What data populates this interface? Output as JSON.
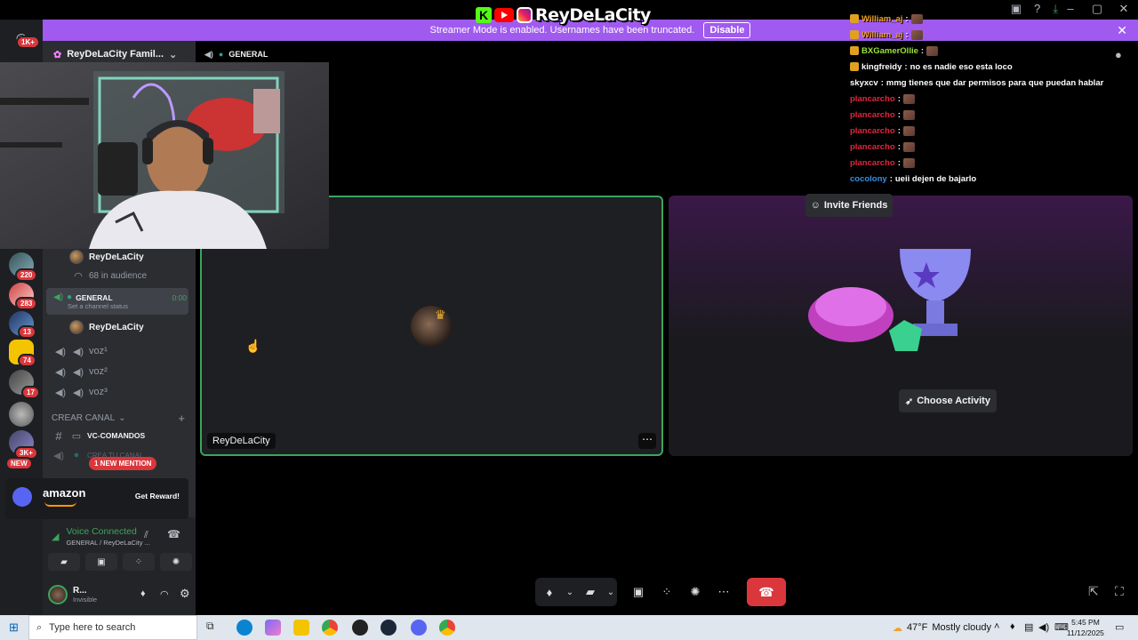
{
  "overlay": {
    "name": "ReyDeLaCity"
  },
  "streamer_bar": {
    "message": "Streamer Mode is enabled. Usernames have been truncated.",
    "disable_label": "Disable"
  },
  "rail_badges": [
    "1K+",
    "220",
    "283",
    "13",
    "74",
    "17",
    "3K+",
    "NEW"
  ],
  "server": {
    "name": "ReyDeLaCity Famil..."
  },
  "header": {
    "channel": "GENERAL"
  },
  "sidebar": {
    "stage_user": "ReyDeLaCity",
    "audience": "68 in audience",
    "active_channel": "GENERAL",
    "active_time": "0:00",
    "channel_status": "Set a channel status",
    "voice_user": "ReyDeLaCity",
    "voz1": "voz¹",
    "voz2": "voz²",
    "voz3": "voz³",
    "category": "CREAR CANAL",
    "vc_comandos": "VC-COMANDOS",
    "crea_canal": "CREA TU CANAL",
    "new_mention": "1 NEW MENTION"
  },
  "amazon": {
    "brand": "amazon",
    "reward": "Get Reward!"
  },
  "voice": {
    "status": "Voice Connected",
    "location": "GENERAL / ReyDeLaCity ..."
  },
  "user": {
    "name": "R...",
    "status": "Invisible"
  },
  "tiles": {
    "user_name": "ReyDeLaCity",
    "invite": "Invite Friends",
    "activity": "Choose Activity"
  },
  "chat": [
    {
      "user": "William_aj",
      "color": "#f0a020",
      "text": "",
      "emote": true,
      "badge": true
    },
    {
      "user": "William_aj",
      "color": "#f0a020",
      "text": "",
      "emote": true,
      "badge": true
    },
    {
      "user": "BXGamerOllie",
      "color": "#9be23a",
      "text": "",
      "emote": true,
      "badge": true
    },
    {
      "user": "kingfreidy",
      "color": "#ffffff",
      "text": "no es nadie eso esta loco",
      "emote": false,
      "badge": true
    },
    {
      "user": "skyxcv",
      "color": "#ffffff",
      "text": "mmg tienes que dar permisos para que puedan hablar",
      "emote": false,
      "badge": false
    },
    {
      "user": "plancarcho",
      "color": "#e0263c",
      "text": "",
      "emote": true,
      "badge": false
    },
    {
      "user": "plancarcho",
      "color": "#e0263c",
      "text": "",
      "emote": true,
      "badge": false
    },
    {
      "user": "plancarcho",
      "color": "#e0263c",
      "text": "",
      "emote": true,
      "badge": false
    },
    {
      "user": "plancarcho",
      "color": "#e0263c",
      "text": "",
      "emote": true,
      "badge": false
    },
    {
      "user": "plancarcho",
      "color": "#e0263c",
      "text": "",
      "emote": true,
      "badge": false
    },
    {
      "user": "cocolony",
      "color": "#3a8ee6",
      "text": "ueii dejen de bajarlo",
      "emote": false,
      "badge": false
    }
  ],
  "taskbar": {
    "search_placeholder": "Type here to search",
    "temperature": "47°F",
    "weather": "Mostly cloudy",
    "time": "5:45 PM",
    "date": "11/12/2025"
  }
}
